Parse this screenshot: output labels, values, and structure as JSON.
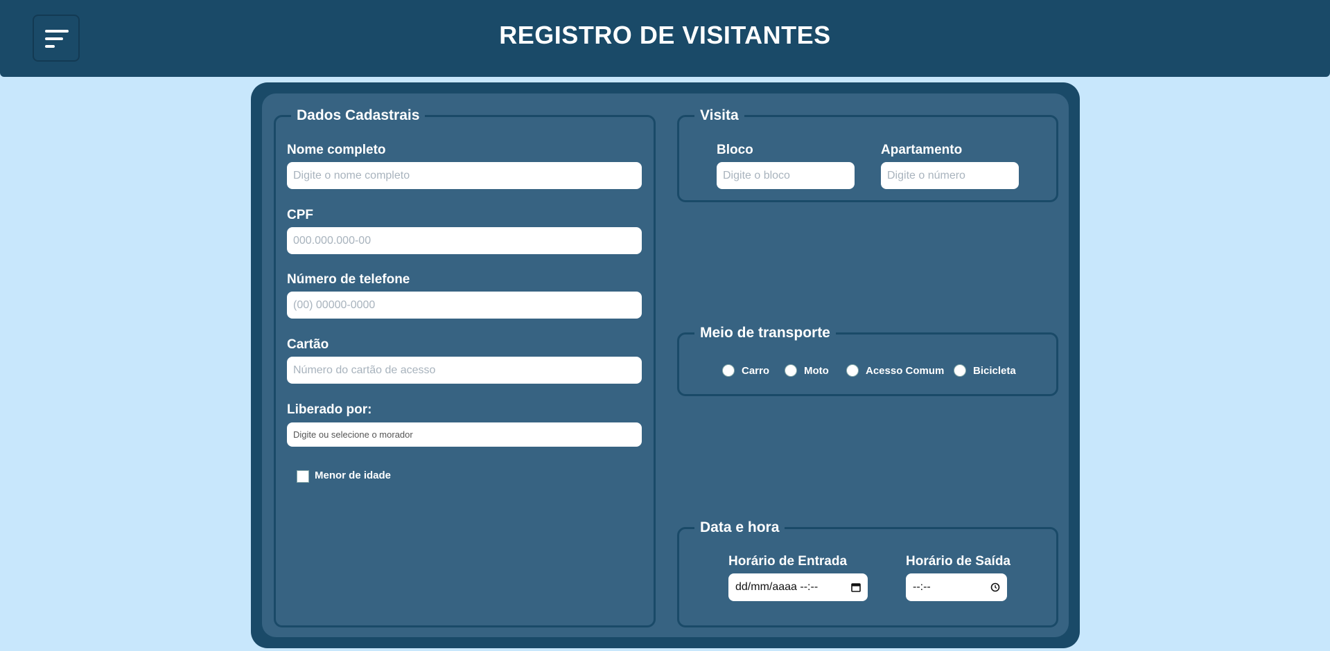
{
  "header": {
    "title": "REGISTRO DE VISITANTES"
  },
  "dados": {
    "legend": "Dados Cadastrais",
    "nome_label": "Nome completo",
    "nome_placeholder": "Digite o nome completo",
    "cpf_label": "CPF",
    "cpf_placeholder": "000.000.000-00",
    "telefone_label": "Número de telefone",
    "telefone_placeholder": "(00) 00000-0000",
    "cartao_label": "Cartão",
    "cartao_placeholder": "Número do cartão de acesso",
    "liberado_label": "Liberado por:",
    "liberado_placeholder": "Digite ou selecione o morador",
    "menor_label": "Menor de idade"
  },
  "visita": {
    "legend": "Visita",
    "bloco_label": "Bloco",
    "bloco_placeholder": "Digite o bloco",
    "apto_label": "Apartamento",
    "apto_placeholder": "Digite o número"
  },
  "transporte": {
    "legend": "Meio de transporte",
    "options": [
      "Carro",
      "Moto",
      "Acesso Comum",
      "Bicicleta"
    ]
  },
  "datahora": {
    "legend": "Data e hora",
    "entrada_label": "Horário de Entrada",
    "entrada_value": "dd/mm/aaaa --:--",
    "saida_label": "Horário de Saída",
    "saida_value": "--:--"
  },
  "icons": {
    "menu": "menu-icon",
    "calendar": "calendar-icon",
    "clock": "clock-icon"
  },
  "colors": {
    "header_bg": "#1a4a68",
    "page_bg": "#c8e7fc",
    "panel_bg": "#376382"
  }
}
